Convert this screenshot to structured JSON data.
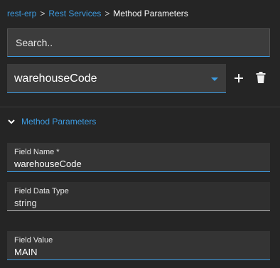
{
  "breadcrumb": {
    "items": [
      "rest-erp",
      "Rest Services"
    ],
    "separator": ">",
    "current": "Method Parameters"
  },
  "search": {
    "placeholder": "Search..",
    "value": ""
  },
  "selector": {
    "selected": "warehouseCode"
  },
  "actions": {
    "add_icon": "plus-icon",
    "delete_icon": "trash-icon"
  },
  "section": {
    "title": "Method Parameters",
    "expanded": true
  },
  "fields": {
    "name": {
      "label": "Field Name *",
      "value": "warehouseCode"
    },
    "type": {
      "label": "Field Data Type",
      "value": "string"
    },
    "value": {
      "label": "Field Value",
      "value": "MAIN"
    }
  },
  "colors": {
    "accent": "#3d9be0",
    "background": "#252525",
    "input_background": "#3c3c3c"
  }
}
